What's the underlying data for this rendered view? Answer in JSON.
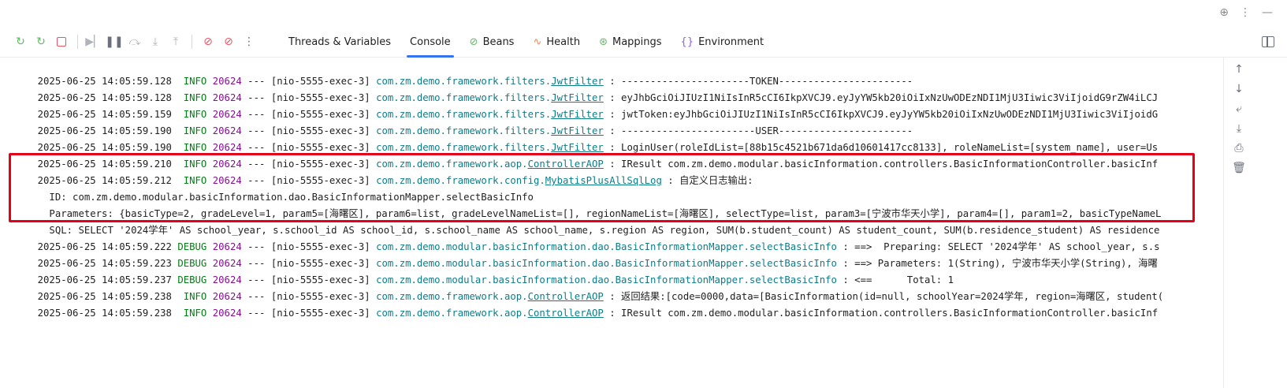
{
  "top_icons": [
    "crosshair-icon",
    "more-vertical-icon",
    "minimize-icon"
  ],
  "toolbar": {
    "icons": [
      "rerun-icon",
      "rerun-failed-icon",
      "stop-icon",
      "resume-icon",
      "pause-icon",
      "step-over-icon",
      "step-into-icon",
      "step-out-icon",
      "breakpoint-icon",
      "mute-breakpoints-icon",
      "more-vertical-icon"
    ],
    "tabs": [
      {
        "label": "Threads & Variables",
        "icon": "",
        "active": false
      },
      {
        "label": "Console",
        "icon": "",
        "active": true
      },
      {
        "label": "Beans",
        "icon": "beans-icon",
        "active": false
      },
      {
        "label": "Health",
        "icon": "health-icon",
        "active": false
      },
      {
        "label": "Mappings",
        "icon": "mappings-icon",
        "active": false
      },
      {
        "label": "Environment",
        "icon": "environment-icon",
        "active": false
      }
    ]
  },
  "log_lines": [
    {
      "ts": "2025-06-25 14:05:59.128",
      "level": " INFO",
      "pid": "20624",
      "sep": " --- ",
      "thread": "[nio-5555-exec-3]",
      "pkg": "com.zm.demo.framework.filters.",
      "cls": "JwtFilter",
      "msg": " : ----------------------TOKEN-----------------------"
    },
    {
      "ts": "2025-06-25 14:05:59.128",
      "level": " INFO",
      "pid": "20624",
      "sep": " --- ",
      "thread": "[nio-5555-exec-3]",
      "pkg": "com.zm.demo.framework.filters.",
      "cls": "JwtFilter",
      "msg": " : eyJhbGciOiJIUzI1NiIsInR5cCI6IkpXVCJ9.eyJyYW5kb20iOiIxNzUwODEzNDI1MjU3Iiwic3ViIjoidG9rZW4iLCJ"
    },
    {
      "ts": "2025-06-25 14:05:59.159",
      "level": " INFO",
      "pid": "20624",
      "sep": " --- ",
      "thread": "[nio-5555-exec-3]",
      "pkg": "com.zm.demo.framework.filters.",
      "cls": "JwtFilter",
      "msg": " : jwtToken:eyJhbGciOiJIUzI1NiIsInR5cCI6IkpXVCJ9.eyJyYW5kb20iOiIxNzUwODEzNDI1MjU3Iiwic3ViIjoidG"
    },
    {
      "ts": "2025-06-25 14:05:59.190",
      "level": " INFO",
      "pid": "20624",
      "sep": " --- ",
      "thread": "[nio-5555-exec-3]",
      "pkg": "com.zm.demo.framework.filters.",
      "cls": "JwtFilter",
      "msg": " : -----------------------USER-----------------------"
    },
    {
      "ts": "2025-06-25 14:05:59.190",
      "level": " INFO",
      "pid": "20624",
      "sep": " --- ",
      "thread": "[nio-5555-exec-3]",
      "pkg": "com.zm.demo.framework.filters.",
      "cls": "JwtFilter",
      "msg": " : LoginUser(roleIdList=[88b15c4521b671da6d10601417cc8133], roleNameList=[system_name], user=Us"
    },
    {
      "ts": "2025-06-25 14:05:59.210",
      "level": " INFO",
      "pid": "20624",
      "sep": " --- ",
      "thread": "[nio-5555-exec-3]",
      "pkg": "com.zm.demo.framework.aop.",
      "cls": "ControllerAOP",
      "msg": " : IResult com.zm.demo.modular.basicInformation.controllers.BasicInformationController.basicInf"
    },
    {
      "ts": "2025-06-25 14:05:59.212",
      "level": " INFO",
      "pid": "20624",
      "sep": " --- ",
      "thread": "[nio-5555-exec-3]",
      "pkg": "com.zm.demo.framework.config.",
      "cls": "MybatisPlusAllSqlLog",
      "msg": " : 自定义日志输出:"
    },
    {
      "plain": "  ID: com.zm.demo.modular.basicInformation.dao.BasicInformationMapper.selectBasicInfo"
    },
    {
      "plain": "  Parameters: {basicType=2, gradeLevel=1, param5=[海曙区], param6=list, gradeLevelNameList=[], regionNameList=[海曙区], selectType=list, param3=[宁波市华天小学], param4=[], param1=2, basicTypeNameL"
    },
    {
      "plain": "  SQL: SELECT '2024学年' AS school_year, s.school_id AS school_id, s.school_name AS school_name, s.region AS region, SUM(b.student_count) AS student_count, SUM(b.residence_student) AS residence"
    },
    {
      "ts": "2025-06-25 14:05:59.222",
      "level": "DEBUG",
      "pid": "20624",
      "sep": " --- ",
      "thread": "[nio-5555-exec-3]",
      "pkg": "com.zm.demo.modular.basicInformation.dao.BasicInformationMapper.selectBasicInfo",
      "cls": "",
      "msg": " : ==>  Preparing: SELECT '2024学年' AS school_year, s.s"
    },
    {
      "ts": "2025-06-25 14:05:59.223",
      "level": "DEBUG",
      "pid": "20624",
      "sep": " --- ",
      "thread": "[nio-5555-exec-3]",
      "pkg": "com.zm.demo.modular.basicInformation.dao.BasicInformationMapper.selectBasicInfo",
      "cls": "",
      "msg": " : ==> Parameters: 1(String), 宁波市华天小学(String), 海曙"
    },
    {
      "ts": "2025-06-25 14:05:59.237",
      "level": "DEBUG",
      "pid": "20624",
      "sep": " --- ",
      "thread": "[nio-5555-exec-3]",
      "pkg": "com.zm.demo.modular.basicInformation.dao.BasicInformationMapper.selectBasicInfo",
      "cls": "",
      "msg": " : <==      Total: 1"
    },
    {
      "ts": "2025-06-25 14:05:59.238",
      "level": " INFO",
      "pid": "20624",
      "sep": " --- ",
      "thread": "[nio-5555-exec-3]",
      "pkg": "com.zm.demo.framework.aop.",
      "cls": "ControllerAOP",
      "msg": " : 返回结果:[code=0000,data=[BasicInformation(id=null, schoolYear=2024学年, region=海曙区, student("
    },
    {
      "ts": "2025-06-25 14:05:59.238",
      "level": " INFO",
      "pid": "20624",
      "sep": " --- ",
      "thread": "[nio-5555-exec-3]",
      "pkg": "com.zm.demo.framework.aop.",
      "cls": "ControllerAOP",
      "msg": " : IResult com.zm.demo.modular.basicInformation.controllers.BasicInformationController.basicInf"
    }
  ],
  "sidebar_icons": [
    "scroll-up-icon",
    "scroll-down-icon",
    "soft-wrap-icon",
    "scroll-to-end-icon",
    "print-icon",
    "clear-all-icon"
  ],
  "colors": {
    "highlight_box": "#e3001b",
    "active_tab_underline": "#3574f0",
    "logger": "#0e7c88",
    "level": "#067d17",
    "pid": "#871094"
  }
}
